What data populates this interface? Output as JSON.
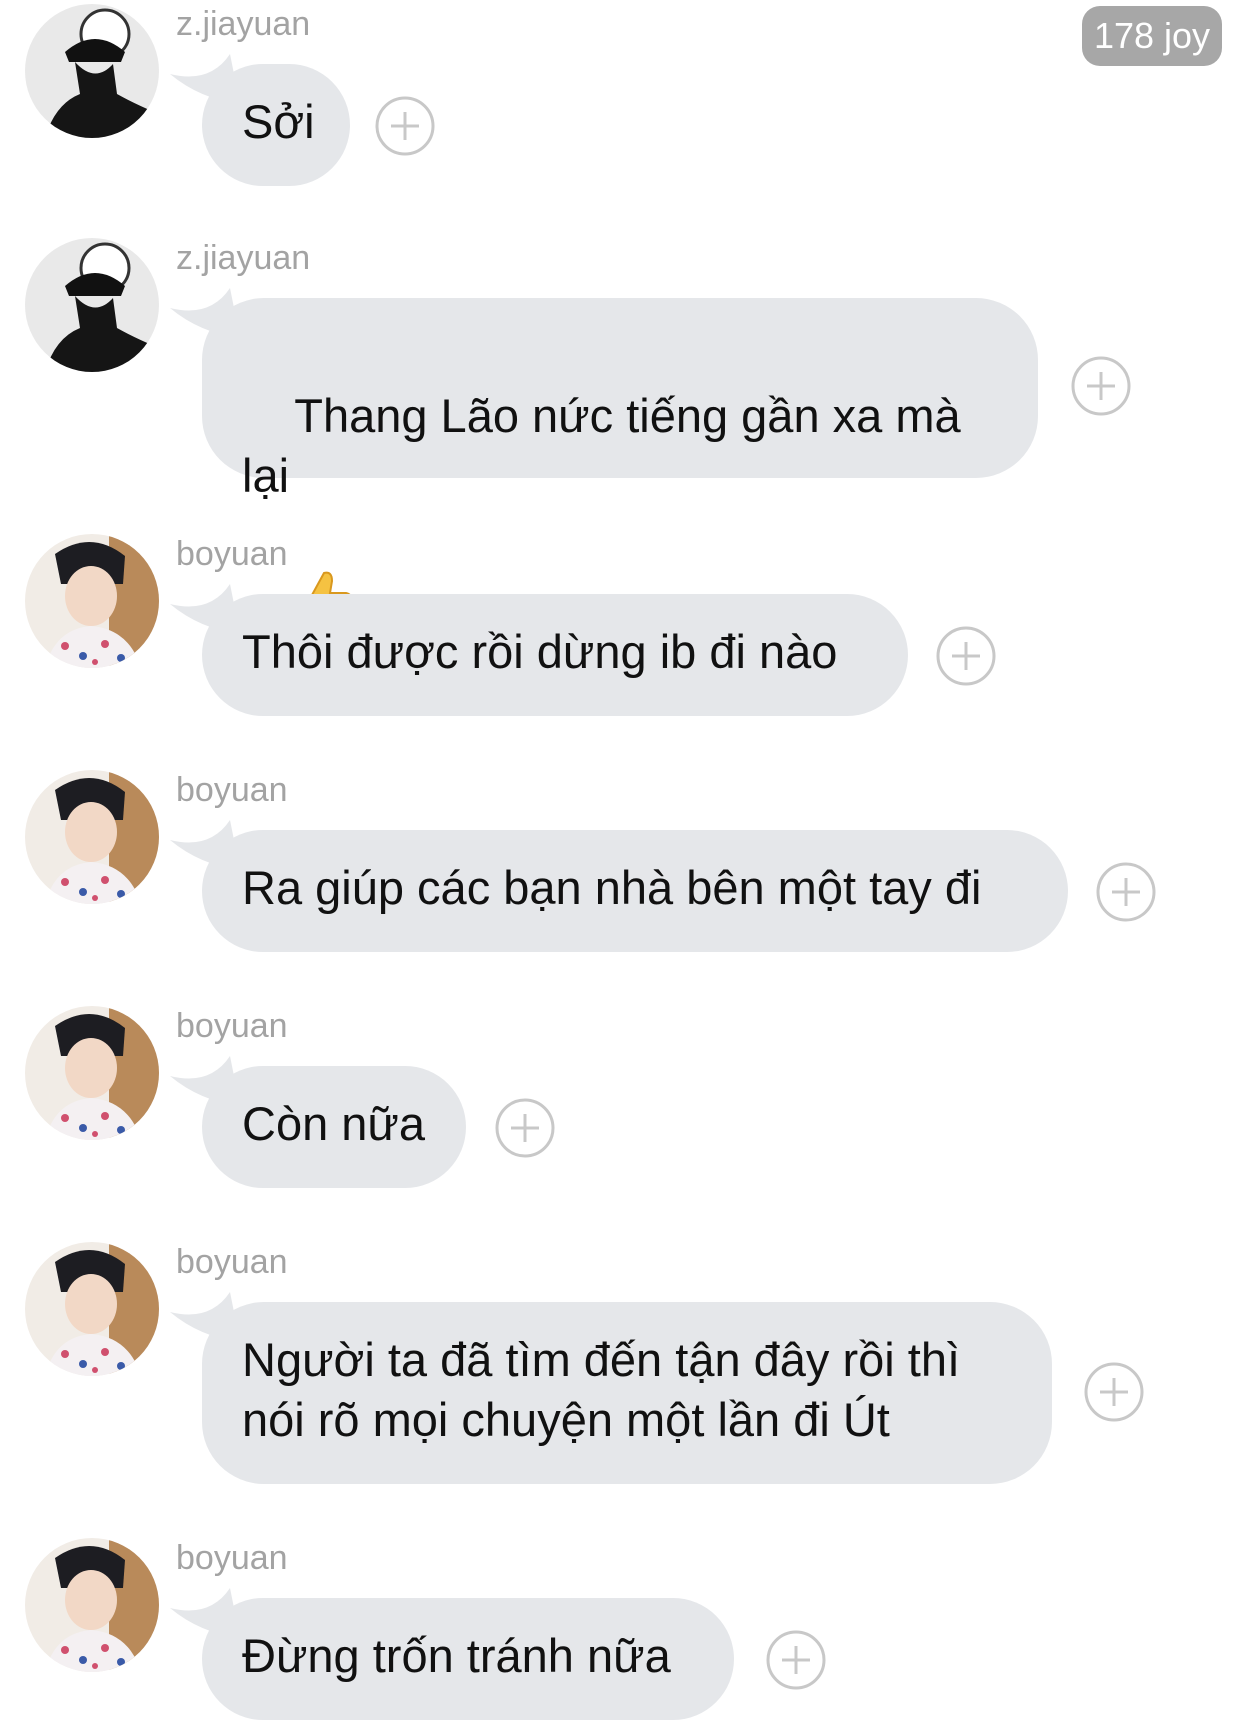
{
  "header": {
    "badge_label": "178 joy"
  },
  "messages": [
    {
      "sender": "z.jiayuan",
      "text": "Sởi",
      "avatar_icon": "dark-hat-figure-avatar"
    },
    {
      "sender": "z.jiayuan",
      "text": "Thang Lão nức tiếng gần xa mà lại",
      "emoji": "thumbs-up-icon",
      "avatar_icon": "dark-hat-figure-avatar"
    },
    {
      "sender": "boyuan",
      "text": "Thôi được rồi dừng ib đi nào",
      "avatar_icon": "boy-portrait-avatar"
    },
    {
      "sender": "boyuan",
      "text": "Ra giúp các bạn nhà bên một tay đi",
      "avatar_icon": "boy-portrait-avatar"
    },
    {
      "sender": "boyuan",
      "text": "Còn nữa",
      "avatar_icon": "boy-portrait-avatar"
    },
    {
      "sender": "boyuan",
      "text": "Người ta đã tìm đến tận đây rồi thì\nnói rõ mọi chuyện một lần đi Út",
      "avatar_icon": "boy-portrait-avatar"
    },
    {
      "sender": "boyuan",
      "text": "Đừng trốn tránh nữa",
      "avatar_icon": "boy-portrait-avatar"
    }
  ],
  "colors": {
    "bubble": "#e5e7ea",
    "sender_name": "#a3a3a3",
    "badge": "#a7a7a7",
    "plus_icon": "#c8c8c8"
  }
}
